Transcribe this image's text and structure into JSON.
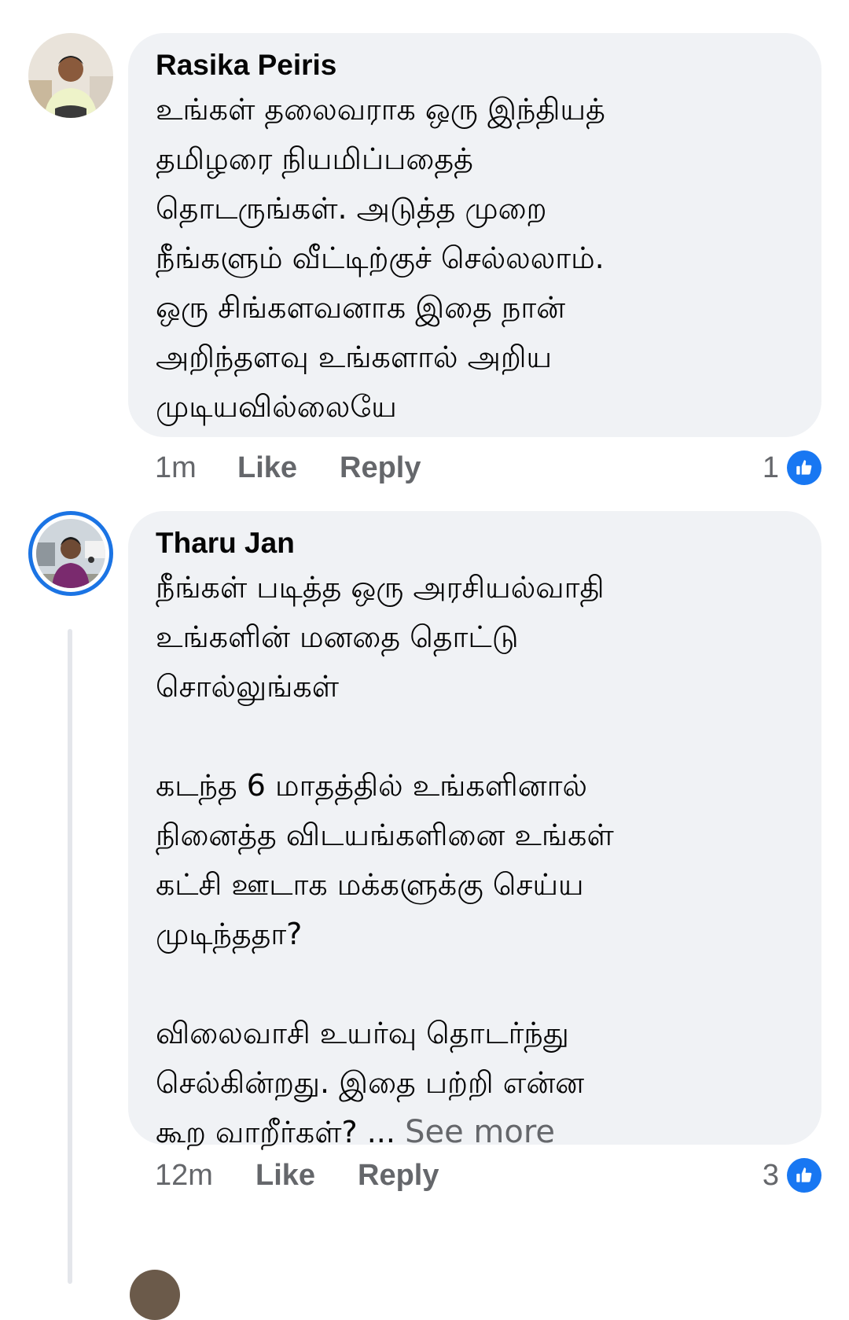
{
  "comments": [
    {
      "author": "Rasika Peiris",
      "text": "உங்கள் தலைவராக ஒரு இந்தியத்\nதமிழரை நியமிப்பதைத்\nதொடருங்கள். அடுத்த முறை\nநீங்களும் வீட்டிற்குச் செல்லலாம்.\nஒரு சிங்களவனாக இதை நான்\nஅறிந்தளவு உங்களால் அறிய\nமுடியவில்லையே",
      "time": "1m",
      "like_label": "Like",
      "reply_label": "Reply",
      "reaction_count": "1",
      "see_more": ""
    },
    {
      "author": "Tharu Jan",
      "text": "நீங்கள் படித்த ஒரு அரசியல்வாதி\nஉங்களின் மனதை தொட்டு\nசொல்லுங்கள்\n\nகடந்த 6 மாதத்தில் உங்களினால்\nநினைத்த விடயங்களினை உங்கள்\nகட்சி ஊடாக மக்களுக்கு செய்ய\nமுடிந்ததா?\n\nவிலைவாசி உயர்வு தொடர்ந்து\nசெல்கின்றது. இதை பற்றி என்ன\nகூற வாறீர்கள்? ...",
      "time": "12m",
      "like_label": "Like",
      "reply_label": "Reply",
      "reaction_count": "3",
      "see_more": "See more"
    }
  ],
  "colors": {
    "bubble_bg": "#f0f2f5",
    "meta_text": "#65676b",
    "like_blue": "#1877f2",
    "ring_blue": "#1b74e4"
  },
  "icons": {
    "reaction": "thumbs-up-icon"
  }
}
